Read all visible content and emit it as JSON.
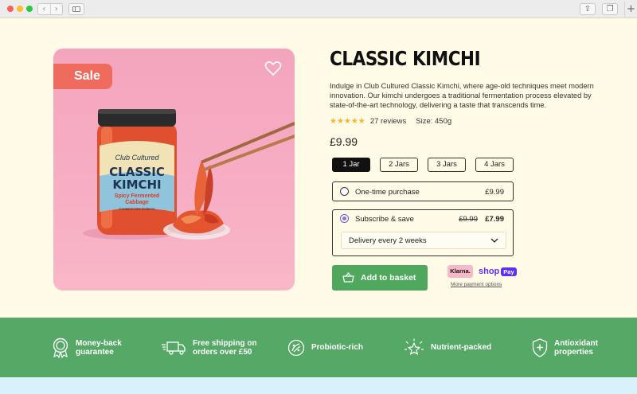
{
  "browser": {
    "back_icon": "chevron-left-icon",
    "forward_icon": "chevron-right-icon",
    "share_icon": "share-icon",
    "tabs_icon": "tabs-icon",
    "new_tab_icon": "plus-icon"
  },
  "product": {
    "sale_badge": "Sale",
    "wishlist_icon": "heart-icon",
    "image_jar_brand": "Club Cultured",
    "image_jar_title_1": "CLASSIC",
    "image_jar_title_2": "KIMCHI",
    "image_jar_subtitle_1": "Spicy Fermented",
    "image_jar_subtitle_2": "Cabbage",
    "image_jar_tagline": "Contains Live Cultures",
    "title": "CLASSIC KIMCHI",
    "description": "Indulge in Club Cultured Classic Kimchi, where age-old techniques meet modern innovation. Our kimchi undergoes a traditional fermentation process elevated by state-of-the-art technology, delivering a taste that transcends time.",
    "rating": 5,
    "reviews": "27 reviews",
    "size": "Size: 450g",
    "price": "£9.99"
  },
  "quantity_options": [
    {
      "label": "1 Jar",
      "selected": true
    },
    {
      "label": "2 Jars",
      "selected": false
    },
    {
      "label": "3 Jars",
      "selected": false
    },
    {
      "label": "4 Jars",
      "selected": false
    }
  ],
  "purchase_options": {
    "one_time": {
      "label": "One-time purchase",
      "price": "£9.99",
      "selected": false
    },
    "subscribe": {
      "label": "Subscribe & save",
      "old_price": "£9.99",
      "price": "£7.99",
      "selected": true
    },
    "delivery_select": "Delivery every 2 weeks"
  },
  "actions": {
    "add_to_basket": "Add to basket",
    "basket_icon": "basket-icon",
    "klarna": "Klarna.",
    "shop_pay_text": "shop",
    "shop_pay_badge": "Pay",
    "more_payment_options": "More payment options"
  },
  "features": [
    {
      "icon": "money-back-badge-icon",
      "line1": "Money-back",
      "line2": "guarantee"
    },
    {
      "icon": "delivery-truck-icon",
      "line1": "Free shipping on",
      "line2": "orders over £50"
    },
    {
      "icon": "probiotic-icon",
      "line1": "Probiotic-rich",
      "line2": ""
    },
    {
      "icon": "sparkle-star-icon",
      "line1": "Nutrient-packed",
      "line2": ""
    },
    {
      "icon": "shield-plus-icon",
      "line1": "Antioxidant",
      "line2": "properties"
    }
  ],
  "colors": {
    "background": "#fffbe6",
    "accent_green": "#4fa85d",
    "band_green": "#55a866",
    "sale_red": "#ee6b5d",
    "image_pink": "#f6a9bf",
    "star_yellow": "#f2b632"
  }
}
